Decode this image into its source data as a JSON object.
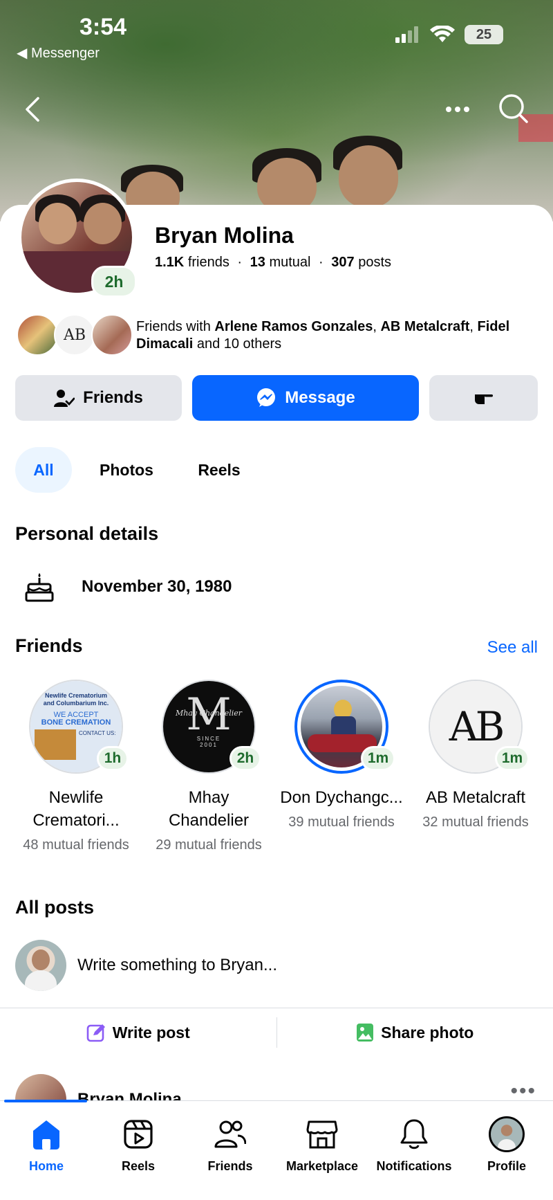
{
  "status_bar": {
    "time": "3:54",
    "back_app": "Messenger",
    "battery": "25"
  },
  "profile": {
    "name": "Bryan Molina",
    "story_age": "2h",
    "friends_count": "1.1K",
    "friends_label": "friends",
    "mutual_count": "13",
    "mutual_label": "mutual",
    "posts_count": "307",
    "posts_label": "posts",
    "separator": "·"
  },
  "mutual_friends": {
    "prefix": "Friends with ",
    "name1": "Arlene Ramos Gonzales",
    "sep1": ", ",
    "name2": "AB Metalcraft",
    "sep2": ", ",
    "name3": "Fidel Dimacali",
    "suffix": " and 10 others",
    "ab_logo_text": "AB"
  },
  "actions": {
    "friends_label": "Friends",
    "message_label": "Message"
  },
  "tabs": [
    {
      "label": "All",
      "active": true
    },
    {
      "label": "Photos",
      "active": false
    },
    {
      "label": "Reels",
      "active": false
    }
  ],
  "personal_details": {
    "title": "Personal details",
    "birthday": "November 30, 1980"
  },
  "friends_section": {
    "title": "Friends",
    "see_all": "See all",
    "items": [
      {
        "name": "Newlife Crematori...",
        "mutual": "48 mutual friends",
        "age": "1h",
        "logo_lines": [
          "Newlife Crematorium",
          "and Columbarium Inc.",
          "WE ACCEPT",
          "BONE CREMATION",
          "CONTACT US:"
        ]
      },
      {
        "name": "Mhay Chandelier",
        "mutual": "29 mutual friends",
        "age": "2h",
        "logo_letter": "M",
        "logo_script": "Mhay Chandelier",
        "logo_since": "SINCE",
        "logo_year": "2001"
      },
      {
        "name": "Don Dychangc...",
        "mutual": "39 mutual friends",
        "age": "1m"
      },
      {
        "name": "AB Metalcraft",
        "mutual": "32 mutual friends",
        "age": "1m",
        "logo_letters": "AB"
      }
    ]
  },
  "all_posts": {
    "title": "All posts",
    "composer_placeholder": "Write something to Bryan...",
    "write_post": "Write post",
    "share_photo": "Share photo",
    "preview_name": "Bryan Molina",
    "more_dots": "•••"
  },
  "bottom_nav": [
    {
      "label": "Home",
      "icon": "home-icon",
      "active": true
    },
    {
      "label": "Reels",
      "icon": "reels-icon",
      "active": false
    },
    {
      "label": "Friends",
      "icon": "friends-icon",
      "active": false
    },
    {
      "label": "Marketplace",
      "icon": "marketplace-icon",
      "active": false
    },
    {
      "label": "Notifications",
      "icon": "bell-icon",
      "active": false
    },
    {
      "label": "Profile",
      "icon": "profile-avatar",
      "active": false
    }
  ],
  "colors": {
    "accent": "#0866ff",
    "button_gray": "#e4e6eb",
    "badge_green": "#1e6b2d"
  }
}
